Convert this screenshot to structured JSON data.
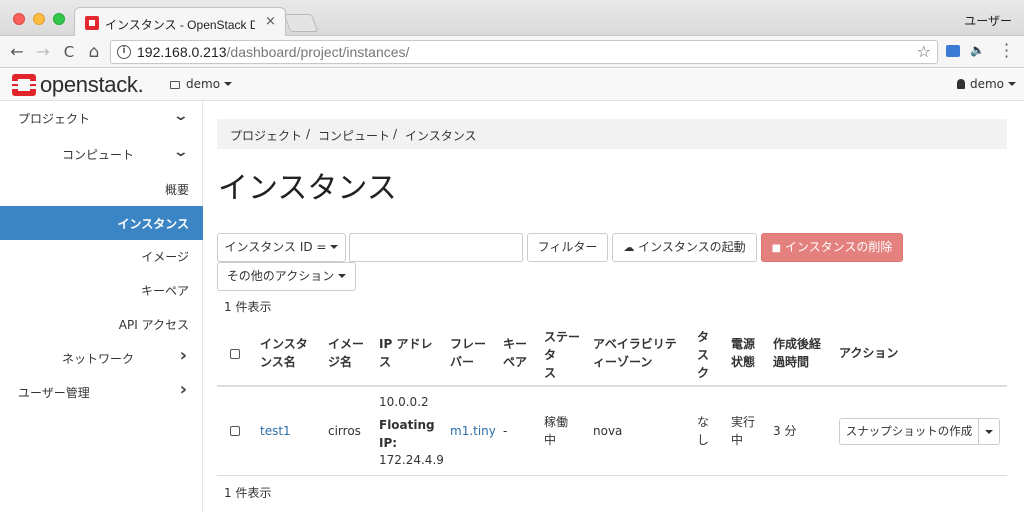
{
  "browser": {
    "tab_title": "インスタンス - OpenStack Dash",
    "tab_close": "×",
    "user_label": "ユーザー",
    "url_host": "192.168.0.213",
    "url_path": "/dashboard/project/instances/",
    "back": "←",
    "forward": "→",
    "reload": "C",
    "home": "⌂",
    "star": "☆",
    "info": "i",
    "audio": "🔈"
  },
  "header": {
    "logo_text": "openstack.",
    "project": "demo",
    "user": "demo"
  },
  "sidebar": {
    "items": [
      {
        "label": "プロジェクト",
        "chevron": "⌄"
      },
      {
        "label": "コンピュート",
        "chevron": "⌄"
      },
      {
        "label": "概要"
      },
      {
        "label": "インスタンス"
      },
      {
        "label": "イメージ"
      },
      {
        "label": "キーペア"
      },
      {
        "label": "API アクセス"
      },
      {
        "label": "ネットワーク",
        "chevron": "›"
      },
      {
        "label": "ユーザー管理",
        "chevron": "›"
      }
    ]
  },
  "main": {
    "breadcrumb": [
      "プロジェクト",
      "/",
      "コンピュート",
      "/",
      "インスタンス"
    ],
    "title": "インスタンス",
    "filter_select": "インスタンス ID =",
    "filter_value": "",
    "filter_button": "フィルター",
    "launch_button": "インスタンスの起動",
    "delete_button": "インスタンスの削除",
    "more_actions": "その他のアクション",
    "count_top": "1 件表示",
    "count_bottom": "1 件表示",
    "columns": {
      "name": [
        "インスタ",
        "ンス名"
      ],
      "image": [
        "イメー",
        "ジ名"
      ],
      "ip": [
        "IP アドレ",
        "ス"
      ],
      "flavor": [
        "フレー",
        "バー"
      ],
      "keypair": [
        "キー",
        "ペア"
      ],
      "status": [
        "ステー",
        "タ",
        "ス"
      ],
      "az": [
        "アベイラビリテ",
        "ィーゾーン"
      ],
      "task": [
        "タ",
        "ス",
        "ク"
      ],
      "power": [
        "電源",
        "状態"
      ],
      "age": [
        "作成後経",
        "過時間"
      ],
      "actions": "アクション"
    },
    "rows": [
      {
        "name": "test1",
        "image": "cirros",
        "ip_1": "10.0.0.2",
        "ip_floating_1": "Floating",
        "ip_floating_2": "IP:",
        "ip_2": "172.24.4.9",
        "flavor": "m1.tiny",
        "keypair": "-",
        "status": [
          "稼働",
          "中"
        ],
        "az": "nova",
        "task": [
          "な",
          "し"
        ],
        "power": [
          "実行",
          "中"
        ],
        "age": "3 分",
        "action": "スナップショットの作成"
      }
    ]
  },
  "colors": {
    "active_nav": "#3c85c4",
    "link": "#2e6fa8",
    "danger_button": "#e4807d",
    "logo_red": "#e1242b"
  }
}
